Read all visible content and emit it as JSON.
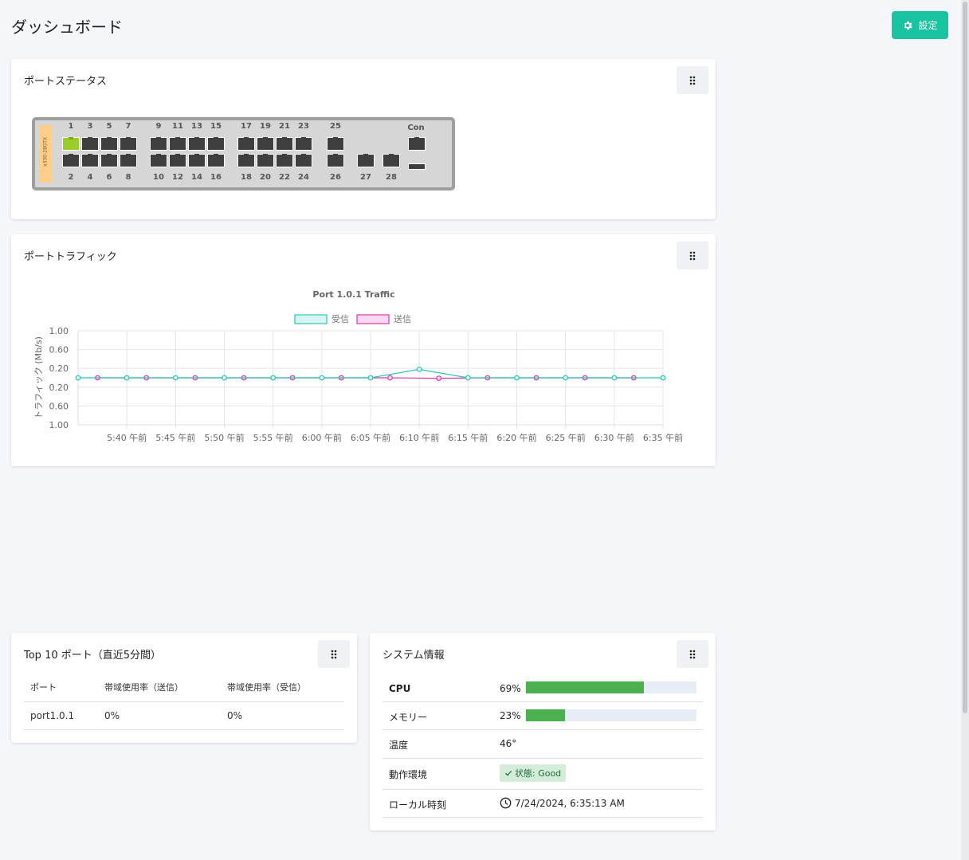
{
  "page": {
    "title": "ダッシュボード",
    "settings_label": "設定"
  },
  "port_status": {
    "title": "ポートステータス",
    "model": "x330-28GTX",
    "con_label": "Con",
    "top_labels": [
      "1",
      "3",
      "5",
      "7",
      "9",
      "11",
      "13",
      "15",
      "17",
      "19",
      "21",
      "23",
      "25"
    ],
    "bottom_labels": [
      "2",
      "4",
      "6",
      "8",
      "10",
      "12",
      "14",
      "16",
      "18",
      "20",
      "22",
      "24",
      "26",
      "27",
      "28"
    ],
    "up_ports": [
      "1"
    ]
  },
  "port_traffic": {
    "title": "ポートトラフィック"
  },
  "chart_data": {
    "type": "line",
    "title": "Port 1.0.1 Traffic",
    "ylabel": "トラフィック (Mb/s)",
    "xlabel": "",
    "y_tick_labels": [
      "1.00",
      "0.60",
      "0.20",
      "0.20",
      "0.60",
      "1.00"
    ],
    "ylim": [
      -1,
      1
    ],
    "x_tick_labels": [
      "5:40 午前",
      "5:45 午前",
      "5:50 午前",
      "5:55 午前",
      "6:00 午前",
      "6:05 午前",
      "6:10 午前",
      "6:15 午前",
      "6:20 午前",
      "6:25 午前",
      "6:30 午前",
      "6:35 午前"
    ],
    "legend_position": "top",
    "grid": true,
    "series": [
      {
        "name": "受信",
        "color": "#2ec4b6",
        "fill": "#d9f5f1",
        "x": [
          "5:35",
          "5:40",
          "5:45",
          "5:50",
          "5:55",
          "6:00",
          "6:05",
          "6:10",
          "6:15",
          "6:20",
          "6:25",
          "6:30",
          "6:35"
        ],
        "values": [
          0,
          0,
          0,
          0,
          0,
          0,
          0,
          0.18,
          0,
          0,
          0,
          0,
          0
        ]
      },
      {
        "name": "送信",
        "color": "#d63aa9",
        "fill": "#fbd9f1",
        "x": [
          "5:37",
          "5:42",
          "5:47",
          "5:52",
          "5:57",
          "6:02",
          "6:07",
          "6:12",
          "6:17",
          "6:22",
          "6:27",
          "6:32"
        ],
        "values": [
          0,
          0,
          0,
          0,
          0,
          0,
          0,
          -0.01,
          0,
          0,
          0,
          0
        ]
      }
    ]
  },
  "top_ports": {
    "title": "Top 10 ポート（直近5分間）",
    "columns": [
      "ポート",
      "帯域使用率（送信）",
      "帯域使用率（受信）"
    ],
    "rows": [
      [
        "port1.0.1",
        "0%",
        "0%"
      ]
    ]
  },
  "system_info": {
    "title": "システム情報",
    "cpu_label": "CPU",
    "cpu_value": "69%",
    "cpu_level": 0.69,
    "memory_label": "メモリー",
    "memory_value": "23%",
    "memory_level": 0.23,
    "temp_label": "温度",
    "temp_value": "46°",
    "env_label": "動作環境",
    "env_value": "状態: Good",
    "time_label": "ローカル時刻",
    "time_value": "7/24/2024, 6:35:13 AM"
  },
  "colors": {
    "accent": "#17c3a1",
    "bar": "#4caf50",
    "port_up": "#9ccc2a"
  }
}
